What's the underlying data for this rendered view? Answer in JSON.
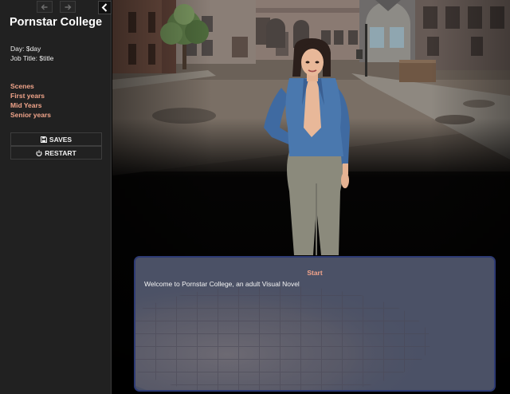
{
  "sidebar": {
    "title": "Pornstar College",
    "day_line": "Day: $day",
    "job_line": "Job Title: $title",
    "menu_links": [
      "Scenes",
      "First years",
      "Mid Years",
      "Senior years"
    ],
    "saves_label": "SAVES",
    "restart_label": "RESTART",
    "icons": {
      "back": "arrow-left-icon",
      "forward": "arrow-right-icon",
      "toggle": "chevron-left-icon",
      "saves": "floppy-disk-icon",
      "restart": "power-icon"
    }
  },
  "dialog": {
    "title": "Start",
    "text": "Welcome to Pornstar College, an adult Visual Novel"
  },
  "colors": {
    "sidebar_bg": "#212121",
    "link_accent": "#f0a48a",
    "dialog_bg": "#4b5166",
    "dialog_border": "#2d3a74"
  }
}
